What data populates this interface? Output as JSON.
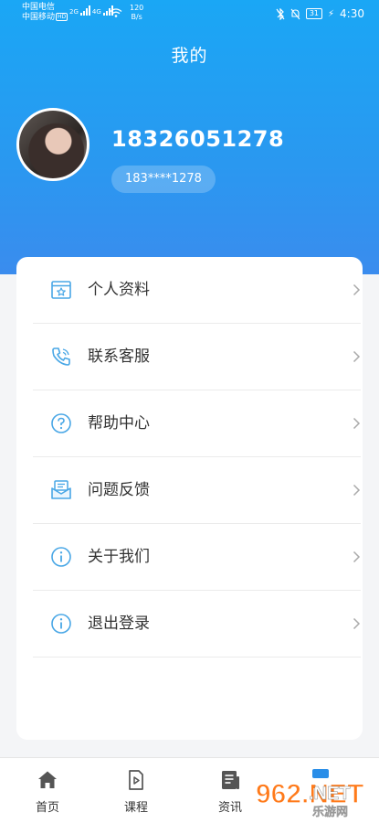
{
  "status_bar": {
    "carrier_1": "中国电信",
    "carrier_2": "中国移动",
    "hd_badge": "HD",
    "net_1": "2G",
    "net_2": "4G",
    "speed_value": "120",
    "speed_unit": "B/s",
    "battery": "31",
    "time": "4:30"
  },
  "header": {
    "title": "我的",
    "phone": "18326051278",
    "masked_phone": "183****1278"
  },
  "menu": [
    {
      "label": "个人资料",
      "icon": "profile-card-icon"
    },
    {
      "label": "联系客服",
      "icon": "phone-icon"
    },
    {
      "label": "帮助中心",
      "icon": "question-icon"
    },
    {
      "label": "问题反馈",
      "icon": "feedback-mail-icon"
    },
    {
      "label": "关于我们",
      "icon": "info-icon"
    },
    {
      "label": "退出登录",
      "icon": "info-icon"
    }
  ],
  "tabbar": [
    {
      "label": "首页",
      "icon": "home-icon"
    },
    {
      "label": "课程",
      "icon": "course-icon"
    },
    {
      "label": "资讯",
      "icon": "news-icon"
    }
  ],
  "watermark": {
    "brand": "962.NET",
    "sub": "乐游网"
  },
  "colors": {
    "accent": "#2aa4f4",
    "icon_blue": "#49a7e6"
  }
}
